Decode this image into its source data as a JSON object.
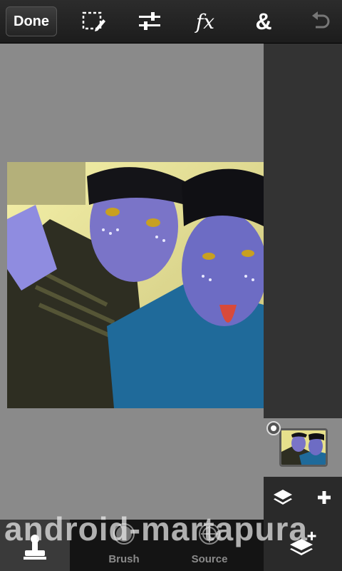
{
  "toolbar": {
    "done_label": "Done",
    "icons": [
      "selection-edit-icon",
      "adjustments-icon",
      "fx-icon",
      "ampersand-icon",
      "undo-icon"
    ],
    "fx_label": "fx",
    "amp_label": "&"
  },
  "canvas": {
    "photo_description_icon": "edited-photo"
  },
  "layers": {
    "selected": true,
    "actions": [
      "layers-icon",
      "add-layer-icon"
    ]
  },
  "bottom_bar": {
    "tabs": [
      {
        "label": "",
        "icon": "stamp-icon",
        "active": true
      },
      {
        "label": "Brush",
        "icon": "brush-icon",
        "active": false
      },
      {
        "label": "Source",
        "icon": "crosshair-icon",
        "active": false
      },
      {
        "label": "",
        "icon": "layers-add-icon",
        "active": false
      }
    ]
  },
  "watermark": "android-martapura",
  "colors": {
    "toolbar_bg": "#1c1c1c",
    "canvas_bg": "#8a8a8a",
    "panel_bg": "#333333"
  }
}
